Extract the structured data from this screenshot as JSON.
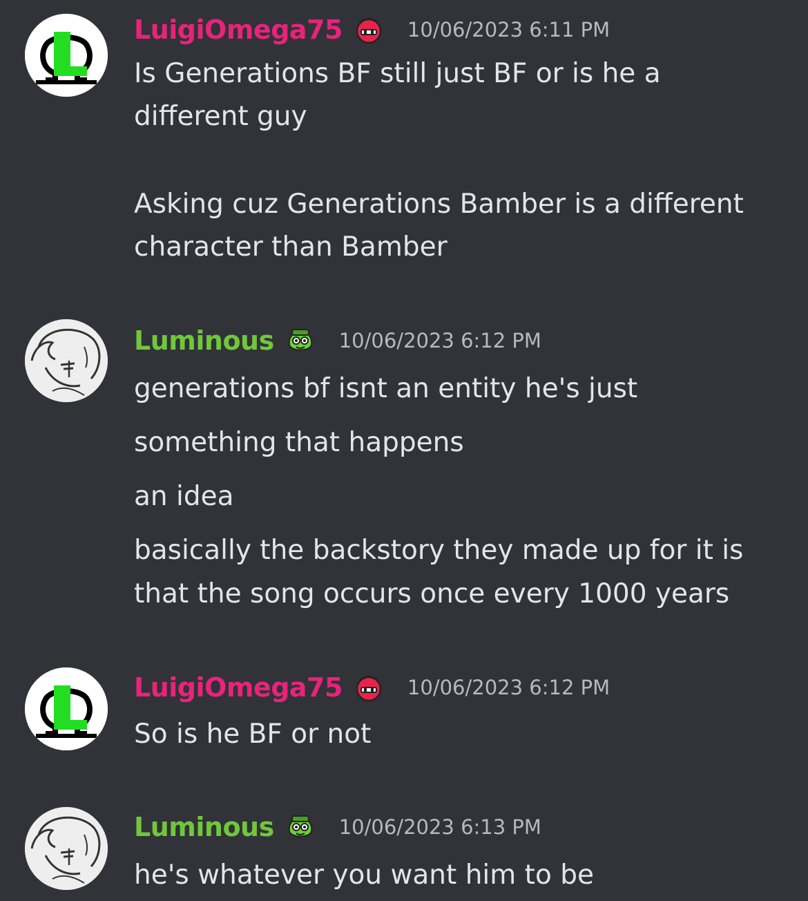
{
  "colors": {
    "background": "#313338",
    "luigi_name": "#e8237a",
    "luminous_name": "#70c73b",
    "text": "#e3e5e8",
    "timestamp": "#b5bac1"
  },
  "messages": [
    {
      "username": "LuigiOmega75",
      "avatar_icon": "omega-L-logo-icon",
      "role_icon": "red-ninja-face-icon",
      "timestamp": "10/06/2023 6:11 PM",
      "lines": [
        "Is Generations BF still just BF or is he a",
        "different guy",
        "",
        "Asking cuz Generations Bamber is a different",
        "character than Bamber"
      ]
    },
    {
      "username": "Luminous",
      "avatar_icon": "sketch-character-icon",
      "role_icon": "green-goggles-face-icon",
      "timestamp": "10/06/2023 6:12 PM",
      "lines": [
        "generations bf isnt an entity he's just",
        "something that happens",
        "an idea",
        "basically the backstory they made up for it is",
        "that the song occurs once every 1000 years"
      ]
    },
    {
      "username": "LuigiOmega75",
      "avatar_icon": "omega-L-logo-icon",
      "role_icon": "red-ninja-face-icon",
      "timestamp": "10/06/2023 6:12 PM",
      "lines": [
        "So is he BF or not"
      ]
    },
    {
      "username": "Luminous",
      "avatar_icon": "sketch-character-icon",
      "role_icon": "green-goggles-face-icon",
      "timestamp": "10/06/2023 6:13 PM",
      "lines": [
        "he's whatever you want him to be"
      ]
    }
  ]
}
